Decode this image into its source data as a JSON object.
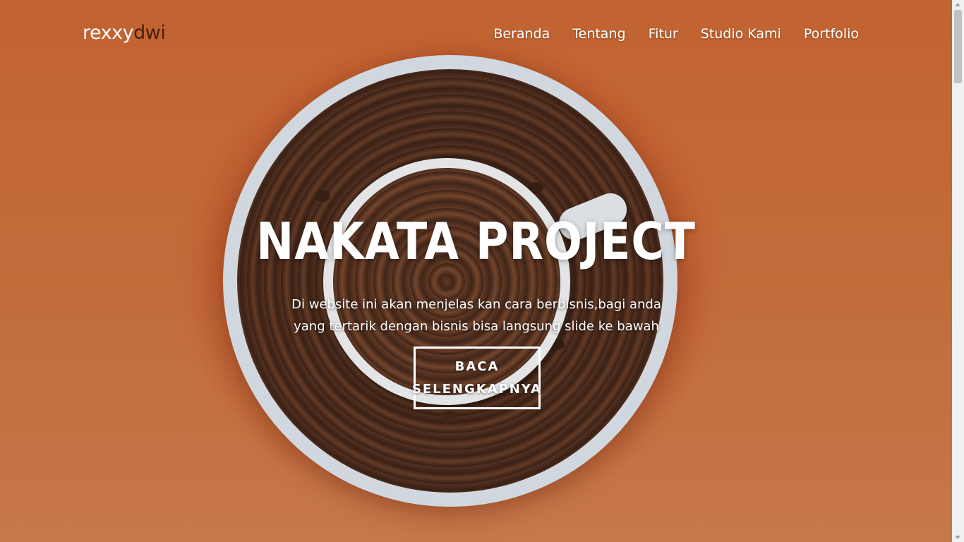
{
  "brand": {
    "part1": "rexxy",
    "part2": "dwi"
  },
  "nav": {
    "items": [
      {
        "label": "Beranda"
      },
      {
        "label": "Tentang"
      },
      {
        "label": "Fitur"
      },
      {
        "label": "Studio Kami"
      },
      {
        "label": "Portfolio"
      }
    ]
  },
  "hero": {
    "title": "NAKATA PROJECT",
    "description": "Di website ini akan menjelas kan cara berbisnis,bagi anda yang tertarik dengan bisnis bisa langsung slide ke bawah",
    "button_line1": "BACA",
    "button_line2": "SELENGKAPNYA"
  },
  "colors": {
    "background": "#c8673a",
    "brand_accent": "#4a1e0a",
    "text": "#ffffff"
  }
}
